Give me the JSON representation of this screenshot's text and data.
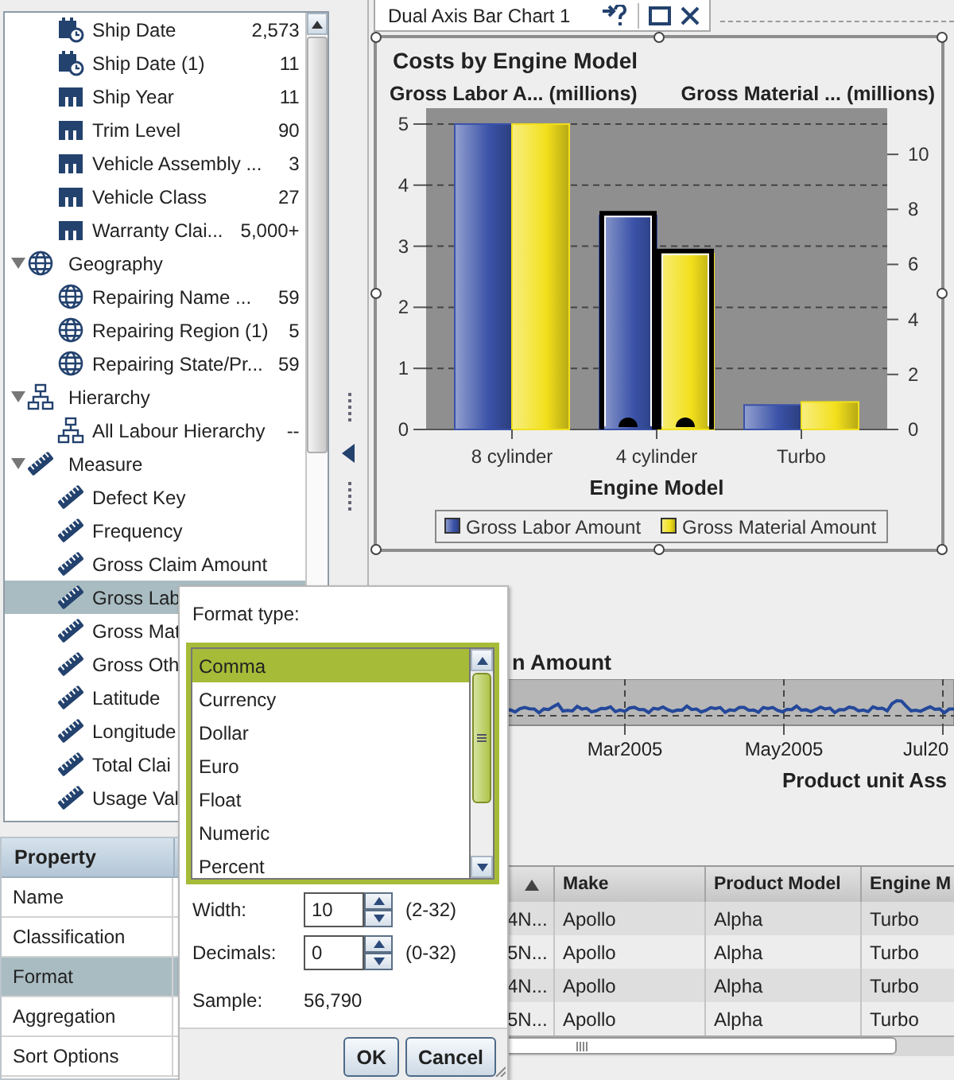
{
  "tree": {
    "continued_items": [
      {
        "label": "Ship Date",
        "count": "2,573",
        "kind": "date",
        "selected": false
      },
      {
        "label": "Ship Date (1)",
        "count": "11",
        "kind": "date",
        "selected": false
      },
      {
        "label": "Ship Year",
        "count": "11",
        "kind": "category",
        "selected": false
      },
      {
        "label": "Trim Level",
        "count": "90",
        "kind": "category",
        "selected": false
      },
      {
        "label": "Vehicle Assembly ...",
        "count": "3",
        "kind": "category",
        "selected": false
      },
      {
        "label": "Vehicle Class",
        "count": "27",
        "kind": "category",
        "selected": false
      },
      {
        "label": "Warranty Clai...",
        "count": "5,000+",
        "kind": "category",
        "selected": false
      }
    ],
    "groups": [
      {
        "label": "Geography",
        "kind": "geography",
        "expanded": true,
        "selected": false,
        "children": [
          {
            "label": "Repairing Name ...",
            "count": "59",
            "kind": "geography",
            "selected": false
          },
          {
            "label": "Repairing Region (1)",
            "count": "5",
            "kind": "geography",
            "selected": false
          },
          {
            "label": "Repairing State/Pr...",
            "count": "59",
            "kind": "geography",
            "selected": false
          }
        ]
      },
      {
        "label": "Hierarchy",
        "kind": "hierarchy",
        "expanded": true,
        "selected": false,
        "children": [
          {
            "label": "All Labour Hierarchy",
            "count": "--",
            "kind": "hierarchy",
            "selected": false
          }
        ]
      },
      {
        "label": "Measure",
        "kind": "measure",
        "expanded": true,
        "selected": false,
        "children": [
          {
            "label": "Defect Key",
            "kind": "measure",
            "selected": false
          },
          {
            "label": "Frequency",
            "kind": "measure",
            "selected": false
          },
          {
            "label": "Gross Claim Amount",
            "kind": "measure",
            "selected": false
          },
          {
            "label": "Gross Lab",
            "kind": "measure",
            "selected": true
          },
          {
            "label": "Gross Mat",
            "kind": "measure",
            "selected": false
          },
          {
            "label": "Gross Oth",
            "kind": "measure",
            "selected": false
          },
          {
            "label": "Latitude",
            "kind": "measure",
            "selected": false
          },
          {
            "label": "Longitude",
            "kind": "measure",
            "selected": false
          },
          {
            "label": "Total Clai",
            "kind": "measure",
            "selected": false
          },
          {
            "label": "Usage Val",
            "kind": "measure",
            "selected": false
          }
        ]
      }
    ]
  },
  "properties": {
    "header": "Property",
    "rows": [
      {
        "name": "Name",
        "selected": false
      },
      {
        "name": "Classification",
        "selected": false
      },
      {
        "name": "Format",
        "selected": true
      },
      {
        "name": "Aggregation",
        "selected": false
      },
      {
        "name": "Sort Options",
        "selected": false
      }
    ]
  },
  "chart_tab": {
    "title": "Dual Axis Bar Chart 1"
  },
  "bar_chart": {
    "chart_data": {
      "type": "bar",
      "title": "Costs by Engine Model",
      "xlabel": "Engine Model",
      "ylabel": "Gross Labor A... (millions)",
      "y2label": "Gross Material ... (millions)",
      "categories": [
        "8 cylinder",
        "4 cylinder",
        "Turbo"
      ],
      "series": [
        {
          "name": "Gross Labor Amount",
          "color": "#3a52a8",
          "values": [
            5.0,
            3.5,
            0.4
          ]
        },
        {
          "name": "Gross Material Amount",
          "color": "#f2e01c",
          "axis": "y2",
          "values": [
            11.1,
            6.4,
            1.0
          ]
        }
      ],
      "ylim": [
        0,
        5.26
      ],
      "yticks": [
        0,
        1,
        2,
        3,
        4,
        5
      ],
      "y2lim": [
        0,
        11.68
      ],
      "y2ticks": [
        0,
        2,
        4,
        6,
        8,
        10
      ],
      "grid": true,
      "legend": "bottom"
    },
    "selected_categories": [
      false,
      true,
      false
    ]
  },
  "time_series": {
    "title": "n Amount",
    "x_tick_labels": [
      "Mar2005",
      "May2005",
      "Jul20"
    ],
    "xlabel": "Product unit Ass"
  },
  "data_table": {
    "columns": [
      {
        "sort_ascending": true
      },
      {
        "label": "Make"
      },
      {
        "label": "Product Model"
      },
      {
        "label": "Engine M"
      }
    ],
    "rows": [
      [
        "4N...",
        "Apollo",
        "Alpha",
        "Turbo"
      ],
      [
        "5N...",
        "Apollo",
        "Alpha",
        "Turbo"
      ],
      [
        "4N...",
        "Apollo",
        "Alpha",
        "Turbo"
      ],
      [
        "5N...",
        "Apollo",
        "Alpha",
        "Turbo"
      ]
    ]
  },
  "format_dialog": {
    "format_type_label": "Format type:",
    "format_types": [
      {
        "label": "Comma",
        "selected": true
      },
      {
        "label": "Currency",
        "selected": false
      },
      {
        "label": "Dollar",
        "selected": false
      },
      {
        "label": "Euro",
        "selected": false
      },
      {
        "label": "Float",
        "selected": false
      },
      {
        "label": "Numeric",
        "selected": false
      },
      {
        "label": "Percent",
        "selected": false
      }
    ],
    "spinners": [
      {
        "label": "Width:",
        "value": "10",
        "range": "(2-32)"
      },
      {
        "label": "Decimals:",
        "value": "0",
        "range": "(0-32)"
      }
    ],
    "sample": {
      "label": "Sample:",
      "value": "56,790"
    },
    "buttons": [
      "OK",
      "Cancel"
    ]
  }
}
